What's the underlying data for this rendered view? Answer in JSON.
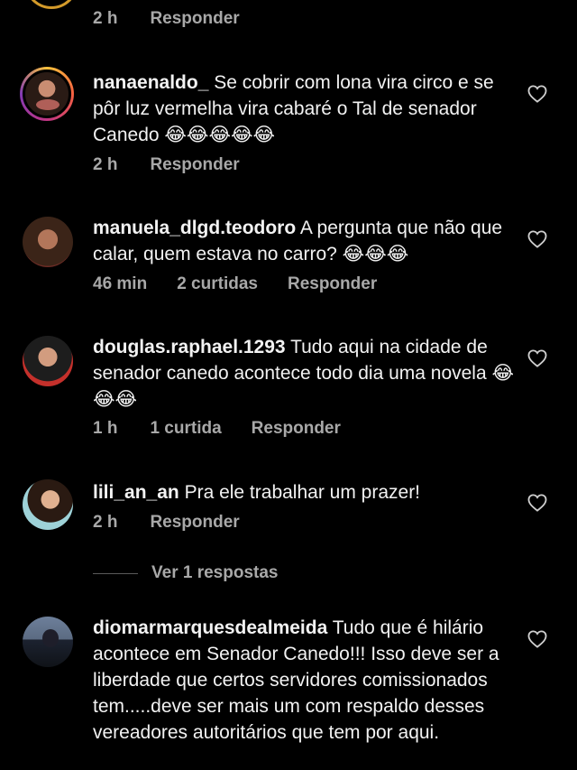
{
  "top": {
    "time": "2 h",
    "reply": "Responder"
  },
  "comments": [
    {
      "user": "nanaenaldo_",
      "text": "Se cobrir com lona vira circo e se pôr luz vermelha vira cabaré o Tal de senador Canedo 😂😂😂😂😂",
      "time": "2 h",
      "likes": "",
      "reply": "Responder"
    },
    {
      "user": "manuela_dlgd.teodoro",
      "text": "A pergunta que não que calar, quem estava no carro? 😂😂😂",
      "time": "46 min",
      "likes": "2 curtidas",
      "reply": "Responder"
    },
    {
      "user": "douglas.raphael.1293",
      "text": "Tudo aqui na cidade de senador canedo acontece  todo dia uma novela 😂😂😂",
      "time": "1 h",
      "likes": "1 curtida",
      "reply": "Responder"
    },
    {
      "user": "lili_an_an",
      "text": "Pra ele trabalhar um prazer!",
      "time": "2 h",
      "likes": "",
      "reply": "Responder"
    },
    {
      "user": "diomarmarquesdealmeida",
      "text": "Tudo que é hilário acontece em Senador Canedo!!! Isso deve ser a liberdade que certos servidores comissionados tem.....deve ser mais um com respaldo desses vereadores autoritários que tem por aqui.",
      "time": "",
      "likes": "",
      "reply": ""
    }
  ],
  "view_replies": "Ver 1 respostas",
  "icons": {
    "like": "heart-outline-icon"
  },
  "colors": {
    "background": "#000000",
    "text": "#f2f2f2",
    "muted": "#a8a8a8"
  }
}
